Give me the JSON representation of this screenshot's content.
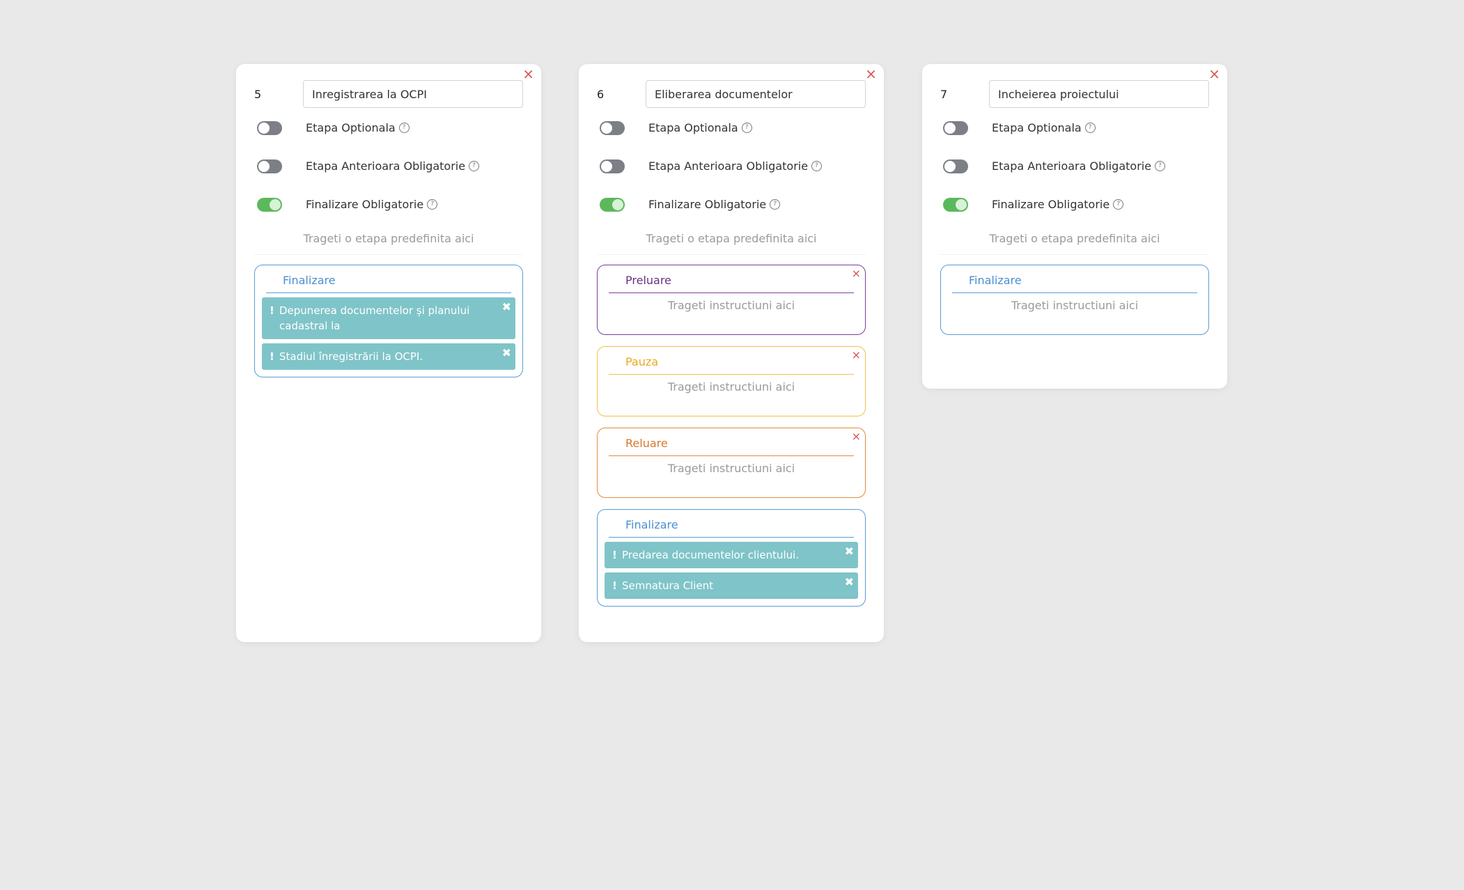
{
  "cards": [
    {
      "number": "5",
      "name": "Inregistrarea la OCPI",
      "toggles": [
        {
          "label": "Etapa Optionala",
          "on": false
        },
        {
          "label": "Etapa Anterioara Obligatorie",
          "on": false
        },
        {
          "label": "Finalizare Obligatorie",
          "on": true
        }
      ],
      "drop_hint": "Trageti o etapa predefinita aici",
      "blocks": [
        {
          "title": "Finalizare",
          "color": "#5b9bd5",
          "items": [
            "Depunerea documentelor și planului cadastral la",
            "Stadiul înregistrării la OCPI."
          ]
        }
      ]
    },
    {
      "number": "6",
      "name": "Eliberarea documentelor",
      "toggles": [
        {
          "label": "Etapa Optionala",
          "on": false
        },
        {
          "label": "Etapa Anterioara Obligatorie",
          "on": false
        },
        {
          "label": "Finalizare Obligatorie",
          "on": true
        }
      ],
      "drop_hint": "Trageti o etapa predefinita aici",
      "blocks": [
        {
          "title": "Preluare",
          "color": "#7b3f9a",
          "hint": "Trageti instructiuni aici"
        },
        {
          "title": "Pauza",
          "color": "#f0c14b",
          "hint": "Trageti instructiuni aici"
        },
        {
          "title": "Reluare",
          "color": "#e08a3c",
          "hint": "Trageti instructiuni aici"
        },
        {
          "title": "Finalizare",
          "color": "#5b9bd5",
          "items": [
            "Predarea documentelor clientului.",
            "Semnatura Client"
          ]
        }
      ]
    },
    {
      "number": "7",
      "name": "Incheierea proiectului",
      "toggles": [
        {
          "label": "Etapa Optionala",
          "on": false
        },
        {
          "label": "Etapa Anterioara Obligatorie",
          "on": false
        },
        {
          "label": "Finalizare Obligatorie",
          "on": true
        }
      ],
      "drop_hint": "Trageti o etapa predefinita aici",
      "blocks": [
        {
          "title": "Finalizare",
          "color": "#5b9bd5",
          "hint": "Trageti instructiuni aici"
        }
      ]
    }
  ],
  "icons": {
    "close": "close-icon",
    "help": "help-icon",
    "remove": "remove-icon",
    "exclamation": "exclamation-icon"
  },
  "close_glyph": "×",
  "remove_glyph": "✖",
  "bang_glyph": "!",
  "help_glyph": "?"
}
